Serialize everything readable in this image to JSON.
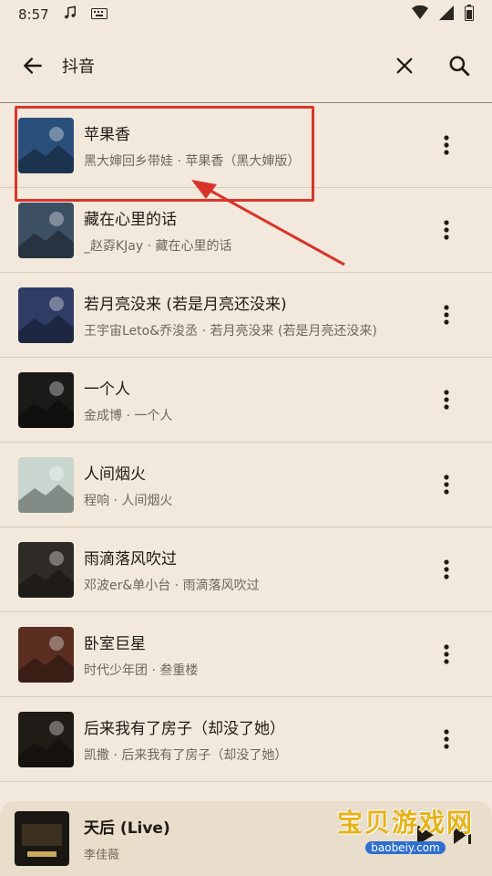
{
  "status_bar": {
    "time": "8:57"
  },
  "search": {
    "query": "抖音"
  },
  "songs": [
    {
      "title": "苹果香",
      "subtitle": "黑大婶回乡带娃 · 苹果香（黑大婶版）",
      "cover_color": "#2a4f7a"
    },
    {
      "title": "藏在心里的话",
      "subtitle": "_赵孬KJay · 藏在心里的话",
      "cover_color": "#3c4f63"
    },
    {
      "title": "若月亮没来 (若是月亮还没来)",
      "subtitle": "王宇宙Leto&乔浚丞 · 若月亮没来 (若是月亮还没来)",
      "cover_color": "#2f3d66"
    },
    {
      "title": "一个人",
      "subtitle": "金成博 · 一个人",
      "cover_color": "#1c1a18"
    },
    {
      "title": "人间烟火",
      "subtitle": "程响 · 人间烟火",
      "cover_color": "#c9d6cf"
    },
    {
      "title": "雨滴落风吹过",
      "subtitle": "邓波er&单小台 · 雨滴落风吹过",
      "cover_color": "#2e2a25"
    },
    {
      "title": "卧室巨星",
      "subtitle": "时代少年团 · 叁重楼",
      "cover_color": "#5a2f22"
    },
    {
      "title": "后来我有了房子（却没了她）",
      "subtitle": "凯撒 · 后来我有了房子（却没了她）",
      "cover_color": "#1f1b17"
    }
  ],
  "now_playing": {
    "title": "天后 (Live)",
    "artist": "李佳薇"
  },
  "watermark": {
    "title": "宝贝游戏网",
    "url": "baobeiy.com"
  },
  "colors": {
    "background": "#f2e9dc",
    "highlight": "#d9342b",
    "mini_player": "#e9ddcb"
  }
}
